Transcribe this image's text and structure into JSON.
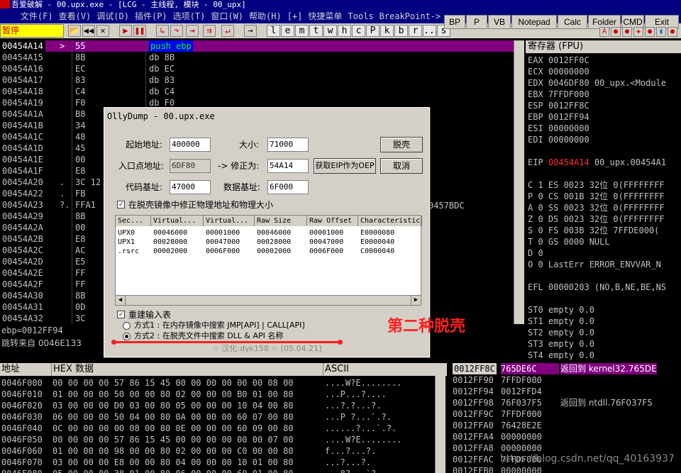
{
  "title": "吾爱破解 - 00.upx.exe - [LCG - 主线程, 模块 - 00_upx]",
  "menu": [
    "文件(F)",
    "查看(V)",
    "调试(D)",
    "插件(P)",
    "选项(T)",
    "窗口(W)",
    "帮助(H)",
    "[+]",
    "快捷菜单",
    "Tools",
    "BreakPoint->"
  ],
  "pause_label": "暂停",
  "toolbar_letters": [
    "l",
    "e",
    "m",
    "t",
    "w",
    "h",
    "c",
    "P",
    "k",
    "b",
    "r",
    "...",
    "s"
  ],
  "right_buttons": [
    "BP",
    "P",
    "VB",
    "Notepad",
    "Calc",
    "Folder",
    "CMD",
    "Exit"
  ],
  "disasm_rows": [
    {
      "addr": "00454A14",
      "mark": ">",
      "hex": "55",
      "ins": "push ebp"
    },
    {
      "addr": "00454A15",
      "mark": "",
      "hex": "8B",
      "ins": "db 8B"
    },
    {
      "addr": "00454A16",
      "mark": "",
      "hex": "EC",
      "ins": "db EC"
    },
    {
      "addr": "00454A17",
      "mark": "",
      "hex": "83",
      "ins": "db 83"
    },
    {
      "addr": "00454A18",
      "mark": "",
      "hex": "C4",
      "ins": "db C4"
    },
    {
      "addr": "00454A19",
      "mark": "",
      "hex": "F0",
      "ins": "db F0"
    },
    {
      "addr": "00454A1A",
      "mark": "",
      "hex": "B8",
      "ins": ""
    },
    {
      "addr": "00454A1B",
      "mark": "",
      "hex": "34",
      "ins": ""
    },
    {
      "addr": "00454A1C",
      "mark": "",
      "hex": "48",
      "ins": ""
    },
    {
      "addr": "00454A1D",
      "mark": "",
      "hex": "45",
      "ins": ""
    },
    {
      "addr": "00454A1E",
      "mark": "",
      "hex": "00",
      "ins": ""
    },
    {
      "addr": "00454A1F",
      "mark": "",
      "hex": "E8",
      "ins": ""
    },
    {
      "addr": "00454A20",
      "mark": ".",
      "hex": "3C 12",
      "ins": ""
    },
    {
      "addr": "00454A22",
      "mark": ".",
      "hex": "FB",
      "ins": ""
    },
    {
      "addr": "00454A23",
      "mark": "?.",
      "hex": "FFA1",
      "ins": ""
    },
    {
      "addr": "00454A29",
      "mark": "",
      "hex": "8B",
      "ins": ""
    },
    {
      "addr": "00454A2A",
      "mark": "",
      "hex": "00",
      "ins": ""
    },
    {
      "addr": "00454A2B",
      "mark": "",
      "hex": "E8",
      "ins": ""
    },
    {
      "addr": "00454A2C",
      "mark": "",
      "hex": "AC",
      "ins": ""
    },
    {
      "addr": "00454A2D",
      "mark": "",
      "hex": "E5",
      "ins": ""
    },
    {
      "addr": "00454A2E",
      "mark": "",
      "hex": "FF",
      "ins": ""
    },
    {
      "addr": "00454A2F",
      "mark": "",
      "hex": "FF",
      "ins": ""
    },
    {
      "addr": "00454A30",
      "mark": "",
      "hex": "8B",
      "ins": ""
    },
    {
      "addr": "00454A31",
      "mark": "",
      "hex": "0D",
      "ins": ""
    },
    {
      "addr": "00454A32",
      "mark": "",
      "hex": "3C",
      "ins": ""
    }
  ],
  "disasm_extra": "0457BDC",
  "regs_header": "寄存器 (FPU)",
  "reg_lines": [
    {
      "t": "EAX 0012FF0C",
      "red": false
    },
    {
      "t": "ECX 00000000",
      "red": false
    },
    {
      "t": "EDX 0046DF80 00_upx.<Module",
      "red": false
    },
    {
      "t": "EBX 7FFDF000",
      "red": false
    },
    {
      "t": "ESP 0012FF8C",
      "red": false
    },
    {
      "t": "EBP 0012FF94",
      "red": false
    },
    {
      "t": "ESI 00000000",
      "red": false
    },
    {
      "t": "EDI 00000000",
      "red": false
    },
    {
      "t": "",
      "red": false
    },
    {
      "t": "EIP 00454A14 00_upx.00454A1",
      "red": true
    },
    {
      "t": "",
      "red": false
    },
    {
      "t": "C 1  ES 0023 32位 0(FFFFFFFF",
      "red": false
    },
    {
      "t": "P 0  CS 001B 32位 0(FFFFFFFF",
      "red": false
    },
    {
      "t": "A 0  SS 0023 32位 0(FFFFFFFF",
      "red": false
    },
    {
      "t": "Z 0  DS 0023 32位 0(FFFFFFFF",
      "red": false
    },
    {
      "t": "S 0  FS 003B 32位 7FFDE000(",
      "red": false
    },
    {
      "t": "T 0  GS 0000 NULL",
      "red": false
    },
    {
      "t": "D 0",
      "red": false
    },
    {
      "t": "O 0  LastErr ERROR_ENVVAR_N",
      "red": false
    },
    {
      "t": "",
      "red": false
    },
    {
      "t": "EFL 00000203 (NO,B,NE,BE,NS",
      "red": false
    },
    {
      "t": "",
      "red": false
    },
    {
      "t": "ST0 empty 0.0",
      "red": false
    },
    {
      "t": "ST1 empty 0.0",
      "red": false
    },
    {
      "t": "ST2 empty 0.0",
      "red": false
    },
    {
      "t": "ST3 empty 0.0",
      "red": false
    },
    {
      "t": "ST4 empty 0.0",
      "red": false
    },
    {
      "t": "ST5 empty 0.0",
      "red": false
    },
    {
      "t": "ST6 empty 0.0",
      "red": false
    }
  ],
  "info_line1": "ebp=0012FF94",
  "info_line2": "跳转来自  0046E133",
  "dump_header": {
    "addr": "地址",
    "hex": "HEX 数据",
    "ascii": "ASCII"
  },
  "dump_rows": [
    {
      "addr": "0046F000",
      "hex": "00 00 00 00 57 86 15 45 00 00 00 00 00 00 08 00",
      "ascii": "....W?E........"
    },
    {
      "addr": "0046F010",
      "hex": "01 00 00 00 50 00 00 80 02 00 00 00 B0 01 00 80",
      "ascii": "...P...?...."
    },
    {
      "addr": "0046F020",
      "hex": "03 00 00 00 D0 03 00 80 05 00 00 00 10 04 00 80",
      "ascii": "...?.?...?."
    },
    {
      "addr": "0046F030",
      "hex": "06 00 00 00 50 04 00 80 0A 00 00 00 60 07 00 80",
      "ascii": "...P ?...`.?."
    },
    {
      "addr": "0046F040",
      "hex": "0C 00 00 00 00 08 00 80 0E 00 00 00 60 09 00 80",
      "ascii": "......?...`.?."
    },
    {
      "addr": "0046F050",
      "hex": "00 00 00 00 57 86 15 45 00 00 00 00 00 00 07 00",
      "ascii": "....W?E........"
    },
    {
      "addr": "0046F060",
      "hex": "01 00 00 00 98 00 00 80 02 00 00 00 C0 00 00 80",
      "ascii": "f...?...?."
    },
    {
      "addr": "0046F070",
      "hex": "03 00 00 00 E8 00 00 80 04 00 00 00 10 01 00 80",
      "ascii": "...?...?."
    },
    {
      "addr": "0046F080",
      "hex": "05 00 00 00 38 01 00 80 06 00 00 00 60 01 00 80",
      "ascii": "...8?...`?"
    }
  ],
  "stack_rows": [
    {
      "addr": "0012FF8C",
      "val": "765DE6C",
      "txt": "返回到 kernel32.765DE",
      "sel": true
    },
    {
      "addr": "0012FF90",
      "val": "7FFDF000",
      "txt": "",
      "sel": false
    },
    {
      "addr": "0012FF94",
      "val": "0012FFD4",
      "txt": "",
      "sel": false
    },
    {
      "addr": "0012FF98",
      "val": "76F037F5",
      "txt": "返回到 ntdll.76F037F5",
      "sel": false
    },
    {
      "addr": "0012FF9C",
      "val": "7FFDF000",
      "txt": "",
      "sel": false
    },
    {
      "addr": "0012FFA0",
      "val": "76428E2E",
      "txt": "",
      "sel": false
    },
    {
      "addr": "0012FFA4",
      "val": "00000000",
      "txt": "",
      "sel": false
    },
    {
      "addr": "0012FFA8",
      "val": "00000000",
      "txt": "",
      "sel": false
    },
    {
      "addr": "0012FFAC",
      "val": "7FFDF000",
      "txt": "",
      "sel": false
    },
    {
      "addr": "0012FFB0",
      "val": "00000000",
      "txt": "",
      "sel": false
    }
  ],
  "dialog": {
    "title": "OllyDump - 00.upx.exe",
    "start_label": "起始地址:",
    "start_value": "400000",
    "size_label": "大小:",
    "size_value": "71000",
    "dump_button": "脱壳",
    "entry_label": "入口点地址:",
    "entry_value": "6DF80",
    "modify_label": "-> 修正为:",
    "modify_value": "54A14",
    "get_eip_button": "获取EIP作为OEP",
    "cancel_button": "取消",
    "code_base_label": "代码基址:",
    "code_base_value": "47000",
    "data_base_label": "数据基址:",
    "data_base_value": "6F000",
    "fix_checkbox": "在脱壳镜像中修正物理地址和物理大小",
    "section_columns": [
      "Sec...",
      "Virtual...",
      "Virtual...",
      "Raw Size",
      "Raw Offset",
      "Characteristic"
    ],
    "sections": [
      [
        "UPX0",
        "00046000",
        "00001000",
        "00046000",
        "00001000",
        "E0000080"
      ],
      [
        "UPX1",
        "00028000",
        "00047000",
        "00028000",
        "00047000",
        "E0000040"
      ],
      [
        ".rsrc",
        "00002000",
        "0006F000",
        "00002000",
        "0006F000",
        "C0000040"
      ]
    ],
    "rebuild_checkbox": "重建输入表",
    "method1": "方式1 : 在内存镜像中搜索 JMP[API] | CALL[API]",
    "method2": "方式2 : 在脱壳文件中搜索 DLL & API 名称",
    "footer": "☆ 汉化:dyk158 ☆ [05.04.21]"
  },
  "annotation": "第二种脱壳",
  "watermark": "https://blog.csdn.net/qq_40163937"
}
